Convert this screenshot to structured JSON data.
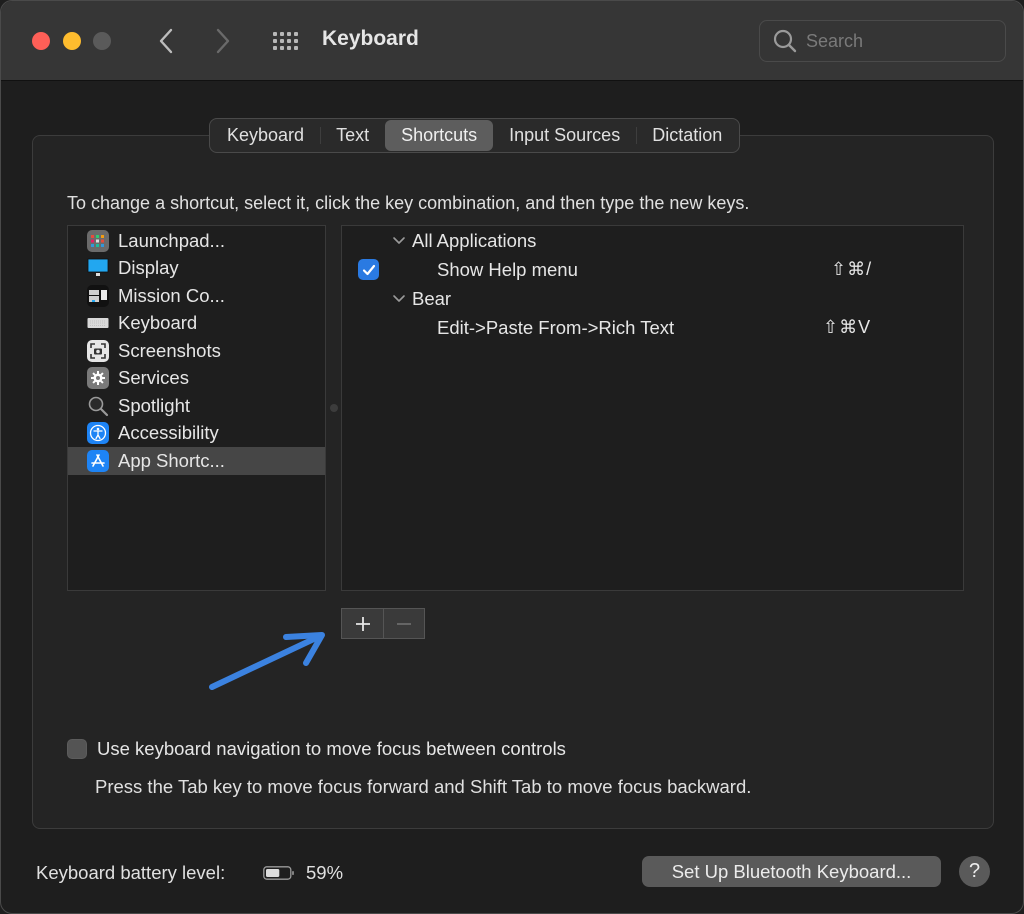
{
  "window": {
    "title": "Keyboard",
    "traffic_lights": {
      "close": "#fe5f57",
      "minimize": "#febc2e",
      "zoom": "#5a5a5a"
    },
    "nav": {
      "back_icon": "chevron-left-icon",
      "forward_icon": "chevron-right-icon",
      "show_all_icon": "grid-icon"
    },
    "search": {
      "placeholder": "Search",
      "value": ""
    }
  },
  "tabs": [
    {
      "label": "Keyboard",
      "active": false
    },
    {
      "label": "Text",
      "active": false
    },
    {
      "label": "Shortcuts",
      "active": true
    },
    {
      "label": "Input Sources",
      "active": false
    },
    {
      "label": "Dictation",
      "active": false
    }
  ],
  "instructions": "To change a shortcut, select it, click the key combination, and then type the new keys.",
  "categories": [
    {
      "label": "Launchpad...",
      "icon": "launchpad-icon",
      "selected": false
    },
    {
      "label": "Display",
      "icon": "display-icon",
      "selected": false
    },
    {
      "label": "Mission Co...",
      "icon": "mission-control-icon",
      "selected": false
    },
    {
      "label": "Keyboard",
      "icon": "keyboard-icon",
      "selected": false
    },
    {
      "label": "Screenshots",
      "icon": "screenshot-icon",
      "selected": false
    },
    {
      "label": "Services",
      "icon": "gear-icon",
      "selected": false
    },
    {
      "label": "Spotlight",
      "icon": "magnifier-icon",
      "selected": false
    },
    {
      "label": "Accessibility",
      "icon": "accessibility-icon",
      "selected": false
    },
    {
      "label": "App Shortc...",
      "icon": "app-store-icon",
      "selected": true
    }
  ],
  "shortcuts": {
    "groups": [
      {
        "label": "All Applications",
        "expanded": true,
        "items": [
          {
            "label": "Show Help menu",
            "keys": "⇧⌘/",
            "enabled": true
          }
        ]
      },
      {
        "label": "Bear",
        "expanded": true,
        "items": [
          {
            "label": "Edit->Paste From->Rich Text",
            "keys": "⇧⌘V",
            "enabled": null
          }
        ]
      }
    ]
  },
  "buttons": {
    "add": "+",
    "remove": "−"
  },
  "annotation": {
    "color": "#3b82e0",
    "points_to": "add-button"
  },
  "keyboard_navigation": {
    "checkbox_label": "Use keyboard navigation to move focus between controls",
    "checked": false,
    "hint": "Press the Tab key to move focus forward and Shift Tab to move focus backward."
  },
  "footer": {
    "battery_label": "Keyboard battery level:",
    "battery_percent": "59%",
    "battery_level": 0.59,
    "bluetooth_button": "Set Up Bluetooth Keyboard...",
    "help_button": "?"
  }
}
